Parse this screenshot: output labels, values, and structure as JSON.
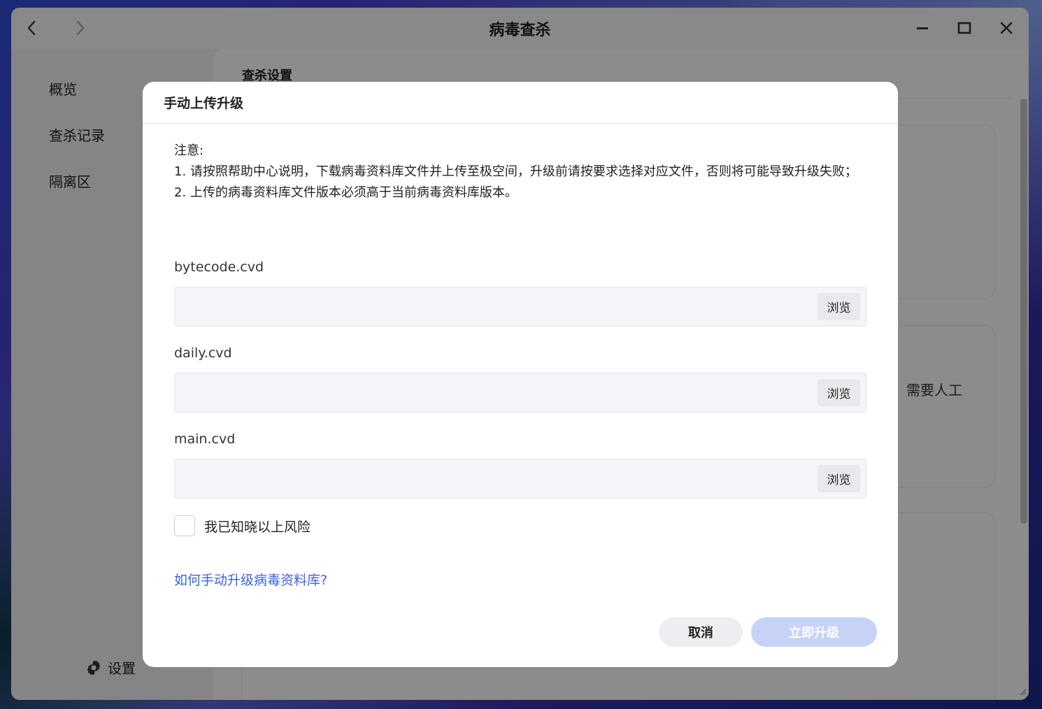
{
  "window": {
    "title": "病毒查杀"
  },
  "sidebar": {
    "items": [
      {
        "label": "概览"
      },
      {
        "label": "查杀记录"
      },
      {
        "label": "隔离区"
      }
    ],
    "settings_label": "设置"
  },
  "main": {
    "section_title": "查杀设置",
    "partial_text": "需要人工"
  },
  "modal": {
    "title": "手动上传升级",
    "notice": {
      "heading": "注意:",
      "line1": "1. 请按照帮助中心说明，下载病毒资料库文件并上传至极空间，升级前请按要求选择对应文件，否则将可能导致升级失败；",
      "line2": "2. 上传的病毒资料库文件版本必须高于当前病毒资料库版本。"
    },
    "fields": [
      {
        "label": "bytecode.cvd",
        "value": "",
        "browse_label": "浏览"
      },
      {
        "label": "daily.cvd",
        "value": "",
        "browse_label": "浏览"
      },
      {
        "label": "main.cvd",
        "value": "",
        "browse_label": "浏览"
      }
    ],
    "acknowledge_label": "我已知晓以上风险",
    "acknowledge_checked": false,
    "help_link": "如何手动升级病毒资料库?",
    "cancel_label": "取消",
    "upgrade_label": "立即升级"
  },
  "colors": {
    "link": "#3b63e0",
    "primary_disabled": "#c7d2f7"
  }
}
